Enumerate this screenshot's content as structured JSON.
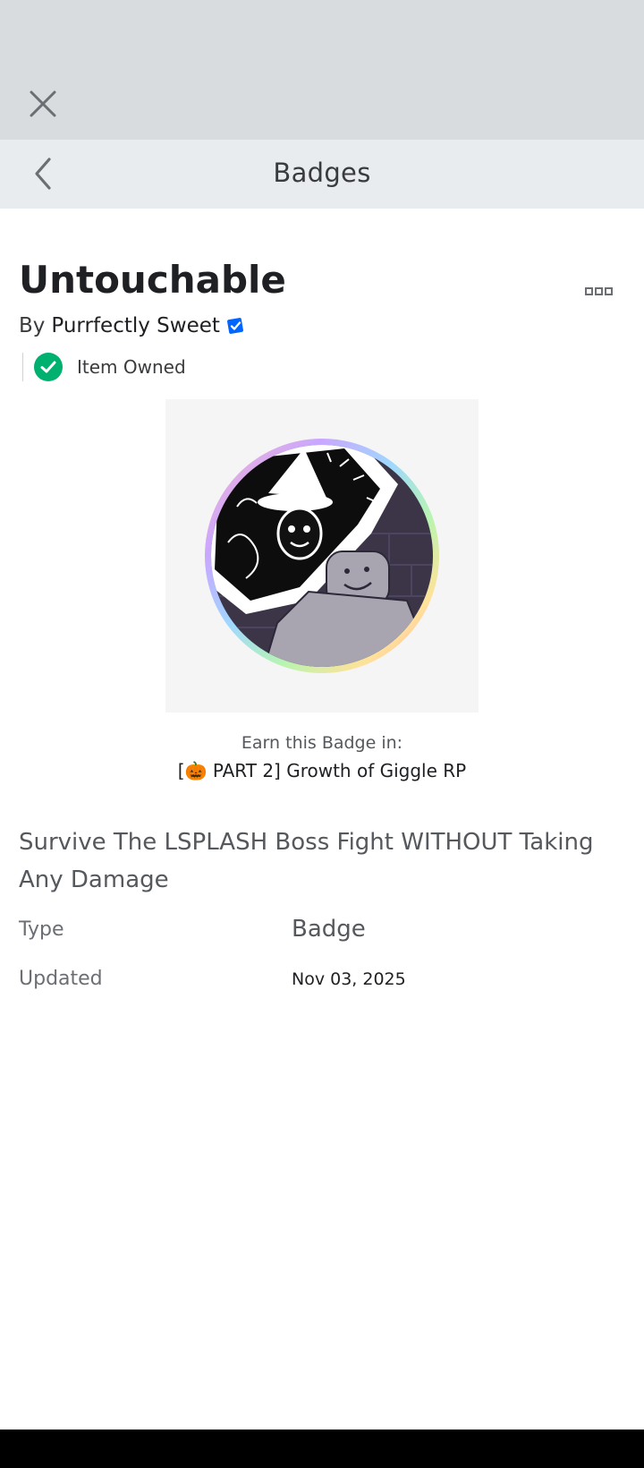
{
  "nav": {
    "title": "Badges"
  },
  "badge": {
    "title": "Untouchable",
    "by_prefix": "By",
    "creator": "Purrfectly Sweet",
    "owned_label": "Item Owned",
    "earn_label": "Earn this Badge in:",
    "game_prefix": "[",
    "game_emoji": "🎃",
    "game_name": " PART 2] Growth of Giggle RP",
    "description": "Survive The LSPLASH Boss Fight WITHOUT Taking Any Damage"
  },
  "details": {
    "type_label": "Type",
    "type_value": "Badge",
    "updated_label": "Updated",
    "updated_value": "Nov 03, 2025"
  },
  "icons": {
    "close": "close-icon",
    "back": "chevron-left-icon",
    "more": "more-options-icon",
    "verified": "verified-badge-icon",
    "owned": "check-circle-icon"
  },
  "colors": {
    "top_bar": "#d9dcdf",
    "nav_bar": "#e9ecef",
    "verified_blue": "#0066ff",
    "owned_green": "#00b06f"
  }
}
